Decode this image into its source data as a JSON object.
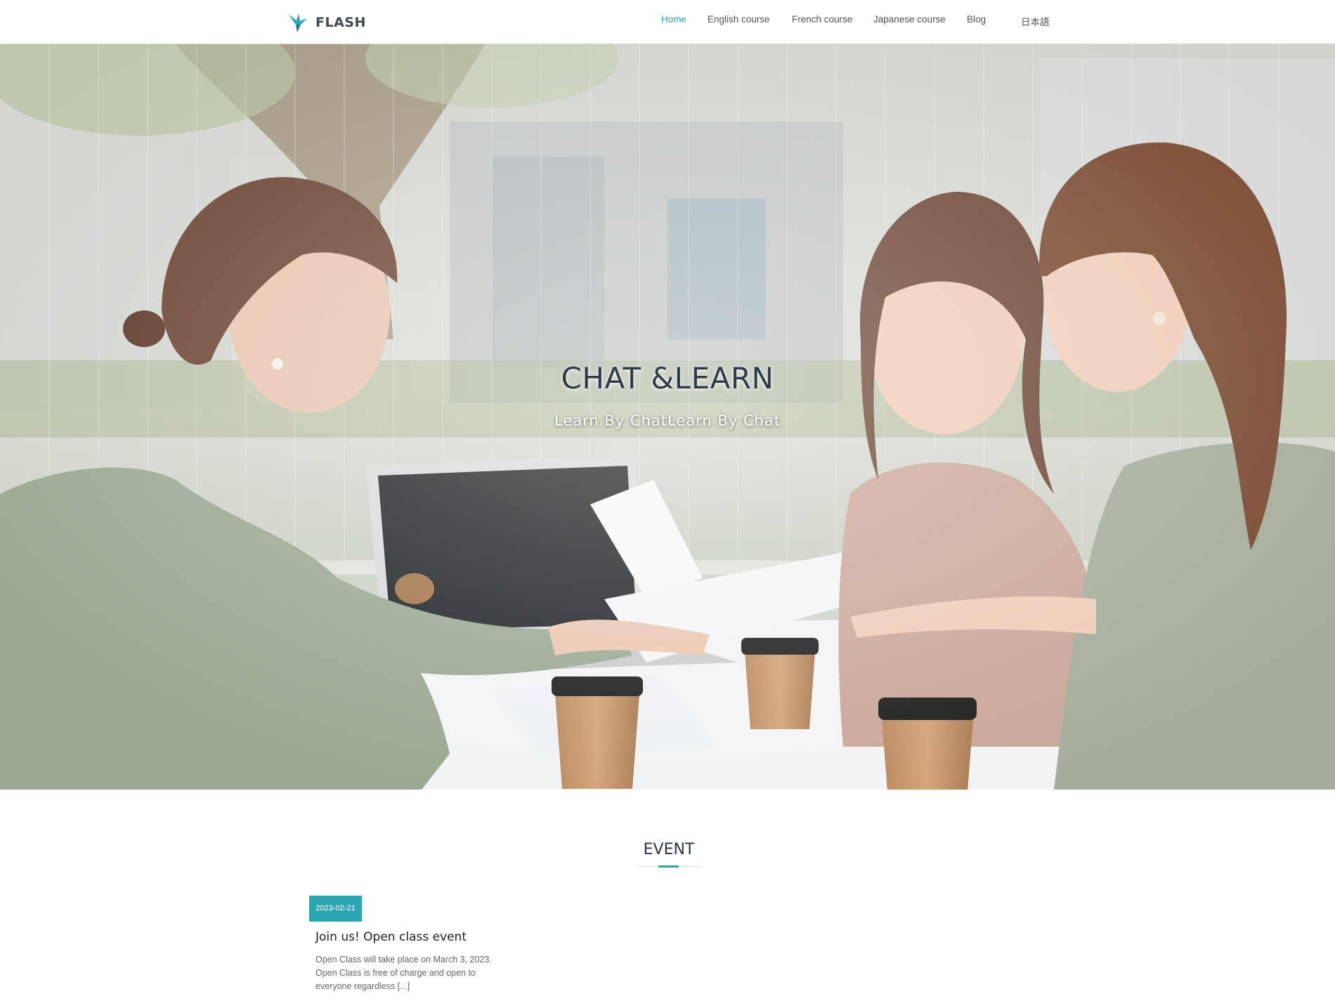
{
  "header": {
    "brand_name": "FLASH",
    "nav": [
      {
        "label": "Home",
        "active": true
      },
      {
        "label": "English course",
        "active": false
      },
      {
        "label": "French course",
        "active": false
      },
      {
        "label": "Japanese course",
        "active": false
      },
      {
        "label": "Blog",
        "active": false
      },
      {
        "label": "日本語",
        "active": false
      }
    ]
  },
  "hero": {
    "title": "CHAT &LEARN",
    "subtitle": "Learn By ChatLearn By Chat"
  },
  "event": {
    "section_title": "EVENT",
    "post": {
      "date": "2023-02-21",
      "title": "Join us! Open class event",
      "excerpt_lines": [
        "Open Class will take place on March 3, 2023.",
        "Open Class is free of charge and open to",
        "everyone regardless [...]"
      ]
    }
  },
  "colors": {
    "accent": "#2ca6b5",
    "heading": "#2c3640"
  }
}
